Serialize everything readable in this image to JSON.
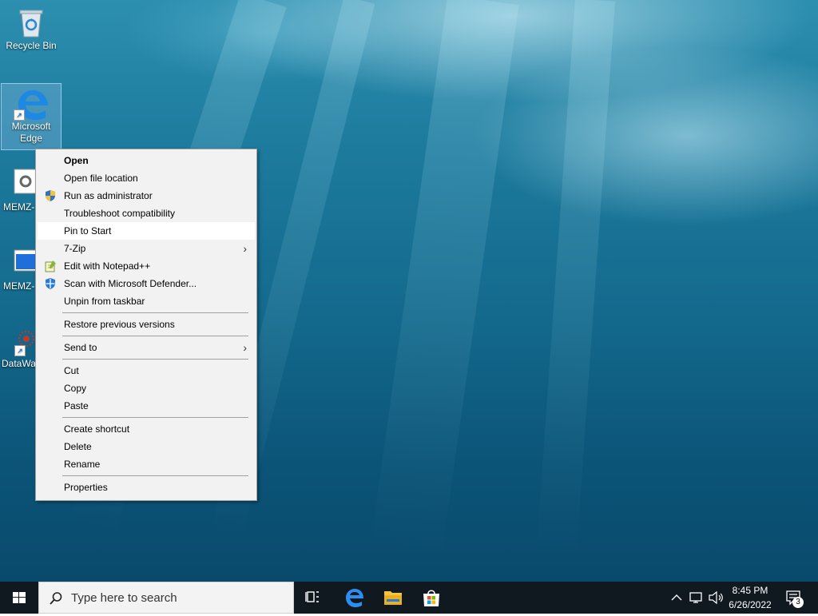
{
  "desktop": {
    "icons": [
      {
        "label": "Recycle Bin"
      },
      {
        "label": "Microsoft Edge"
      },
      {
        "label": "MEMZ-"
      },
      {
        "label": "MEMZ-"
      },
      {
        "label": "DataWa"
      }
    ]
  },
  "context_menu": {
    "items": [
      {
        "label": "Open",
        "bold": true
      },
      {
        "label": "Open file location"
      },
      {
        "label": "Run as administrator",
        "icon": "uac-shield-icon"
      },
      {
        "label": "Troubleshoot compatibility"
      },
      {
        "label": "Pin to Start",
        "highlighted": true
      },
      {
        "label": "7-Zip",
        "submenu": true
      },
      {
        "label": "Edit with Notepad++",
        "icon": "notepadpp-icon"
      },
      {
        "label": "Scan with Microsoft Defender...",
        "icon": "defender-icon"
      },
      {
        "label": "Unpin from taskbar"
      },
      {
        "label": "Restore previous versions"
      },
      {
        "label": "Send to",
        "submenu": true
      },
      {
        "label": "Cut"
      },
      {
        "label": "Copy"
      },
      {
        "label": "Paste"
      },
      {
        "label": "Create shortcut"
      },
      {
        "label": "Delete"
      },
      {
        "label": "Rename"
      },
      {
        "label": "Properties"
      }
    ]
  },
  "taskbar": {
    "search_placeholder": "Type here to search",
    "time": "8:45 PM",
    "date": "6/26/2022",
    "notification_count": "3"
  },
  "colors": {
    "taskbar": "#101820",
    "menu_bg": "#f2f2f2",
    "accent": "#0078d7"
  }
}
